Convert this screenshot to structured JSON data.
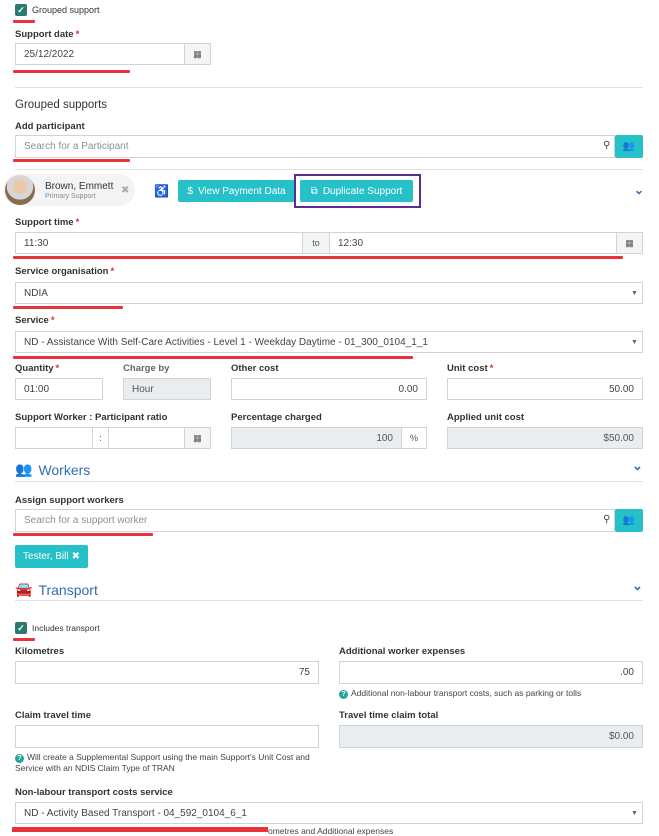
{
  "grouped_support": {
    "label": "Grouped support",
    "checked": true
  },
  "support_date": {
    "label": "Support date",
    "required": "*",
    "value": "25/12/2022"
  },
  "grouped_supports": {
    "heading": "Grouped supports",
    "add_participant_label": "Add participant",
    "search_placeholder": "Search for a Participant"
  },
  "participant": {
    "name": "Brown, Emmett",
    "role": "Primary Support",
    "view_payment_label": "View Payment Data",
    "duplicate_label": "Duplicate Support"
  },
  "support_time": {
    "label": "Support time",
    "required": "*",
    "start": "11:30",
    "to": "to",
    "end": "12:30"
  },
  "service_org": {
    "label": "Service organisation",
    "required": "*",
    "value": "NDIA"
  },
  "service": {
    "label": "Service",
    "required": "*",
    "value": "ND - Assistance With Self-Care Activities - Level 1 - Weekday Daytime - 01_300_0104_1_1"
  },
  "quantity": {
    "label": "Quantity",
    "required": "*",
    "value": "01:00"
  },
  "charge_by": {
    "label": "Charge by",
    "value": "Hour"
  },
  "other_cost": {
    "label": "Other cost",
    "value": "0.00"
  },
  "unit_cost": {
    "label": "Unit cost",
    "required": "*",
    "value": "50.00"
  },
  "ratio": {
    "label": "Support Worker : Participant ratio",
    "sep": ":"
  },
  "percentage": {
    "label": "Percentage charged",
    "value": "100",
    "unit": "%"
  },
  "applied_unit_cost": {
    "label": "Applied unit cost",
    "value": "$50.00"
  },
  "workers": {
    "heading": "Workers",
    "assign_label": "Assign support workers",
    "search_placeholder": "Search for a support worker",
    "tag": "Tester, Bill"
  },
  "transport": {
    "heading": "Transport",
    "includes_label": "Includes transport",
    "km_label": "Kilometres",
    "km_value": "75",
    "additional_label": "Additional worker expenses",
    "additional_value": ".00",
    "additional_help": "Additional non-labour transport costs, such as parking or tolls",
    "claim_label": "Claim travel time",
    "claim_help": "Will create a Supplemental Support using the main Support's Unit Cost and Service with an NDIS Claim Type of TRAN",
    "travel_total_label": "Travel time claim total",
    "travel_total_value": "$0.00",
    "nonlabour_label": "Non-labour transport costs service",
    "nonlabour_value": "ND - Activity Based Transport - 04_592_0104_6_1",
    "cut_text": "ometres and Additional expenses"
  },
  "colors": {
    "teal": "#26c0c9",
    "accent_red": "#e8333b",
    "purple": "#5b2d8e",
    "blue": "#2f6db5"
  }
}
